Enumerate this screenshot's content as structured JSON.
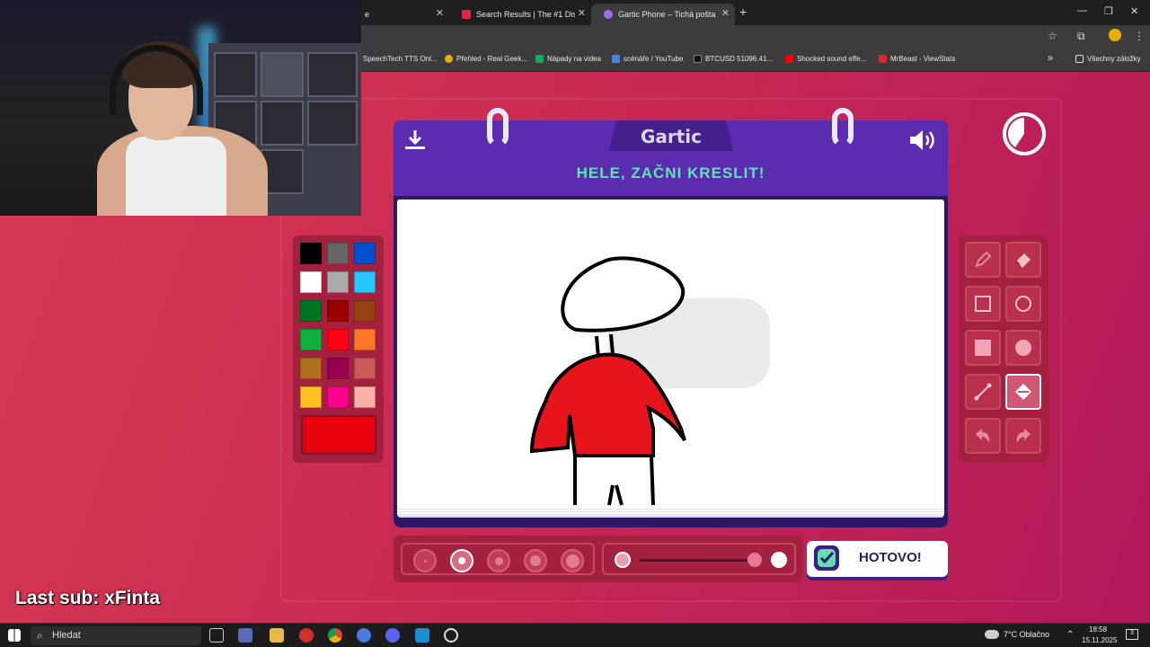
{
  "browser": {
    "tabs": [
      {
        "label": "e",
        "active": false
      },
      {
        "label": "Search Results | The #1 Discord",
        "active": false
      },
      {
        "label": "Gartic Phone – Tichá pošta",
        "active": true
      }
    ],
    "new_tab": "+",
    "window_controls": {
      "minimize": "—",
      "restore": "❐",
      "close": "✕"
    },
    "bookmarks": [
      "SpeechTech TTS Onl...",
      "Přehled - Real Geek...",
      "Nápady na videa",
      "scénáře / YouTube",
      "BTCUSD 51096.41...",
      "Shocked sound effe...",
      "MrBeast - ViewStats"
    ],
    "bookmarks_more": "»",
    "all_bookmarks": "Všechny záložky"
  },
  "game": {
    "logo": "Gartic",
    "instruction": "HELE, ZAČNI KRESLIT!",
    "done_label": "HOTOVO!",
    "palette": [
      "#000000",
      "#666666",
      "#0050cd",
      "#ffffff",
      "#aaaaaa",
      "#26c9ff",
      "#017420",
      "#990000",
      "#964112",
      "#11b03c",
      "#ff0013",
      "#ff7829",
      "#b0701c",
      "#99004e",
      "#cb5a57",
      "#ffc126",
      "#ff008f",
      "#feafa8"
    ],
    "current_color": "#e8000d",
    "tools": [
      "pencil-icon",
      "eraser-icon",
      "rectangle-icon",
      "ellipse-icon",
      "filled-rectangle-icon",
      "filled-ellipse-icon",
      "line-icon",
      "bucket-icon",
      "undo-icon",
      "redo-icon"
    ],
    "active_tool": "bucket-icon",
    "brush_sizes": 5,
    "active_brush_size": 2
  },
  "stream": {
    "last_sub": "Last sub: xFinta"
  },
  "taskbar": {
    "search_placeholder": "Hledat",
    "weather": "7°C  Oblačno",
    "time": "18:58",
    "date": "15.11.2025",
    "notifications": "3"
  }
}
